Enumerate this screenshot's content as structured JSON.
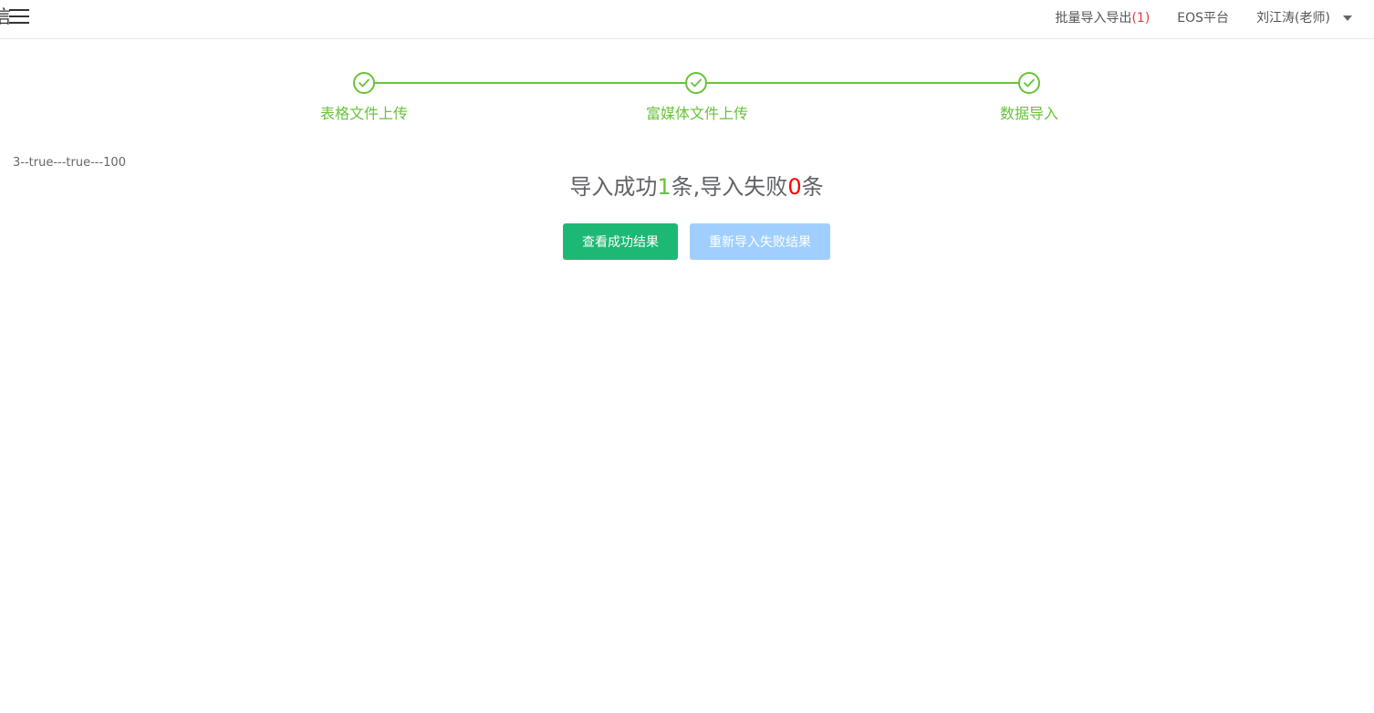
{
  "header": {
    "logo_fragment": "信",
    "links": {
      "batch_label": "批量导入导出",
      "batch_count": "(1)",
      "platform": "EOS平台",
      "user": "刘江涛(老师)"
    }
  },
  "steps": [
    {
      "label": "表格文件上传",
      "status": "finished"
    },
    {
      "label": "富媒体文件上传",
      "status": "finished"
    },
    {
      "label": "数据导入",
      "status": "finished"
    }
  ],
  "debug_text": "3--true---true---100",
  "result": {
    "prefix": "导入成功",
    "success_count": "1",
    "middle": "条,导入失败",
    "fail_count": "0",
    "suffix": "条"
  },
  "buttons": {
    "view_success": "查看成功结果",
    "reimport_failed": "重新导入失败结果"
  },
  "colors": {
    "accent_green": "#67c23a",
    "button_green": "#1db874",
    "button_disabled_blue": "#a0cfff",
    "fail_red": "#ff0000"
  }
}
